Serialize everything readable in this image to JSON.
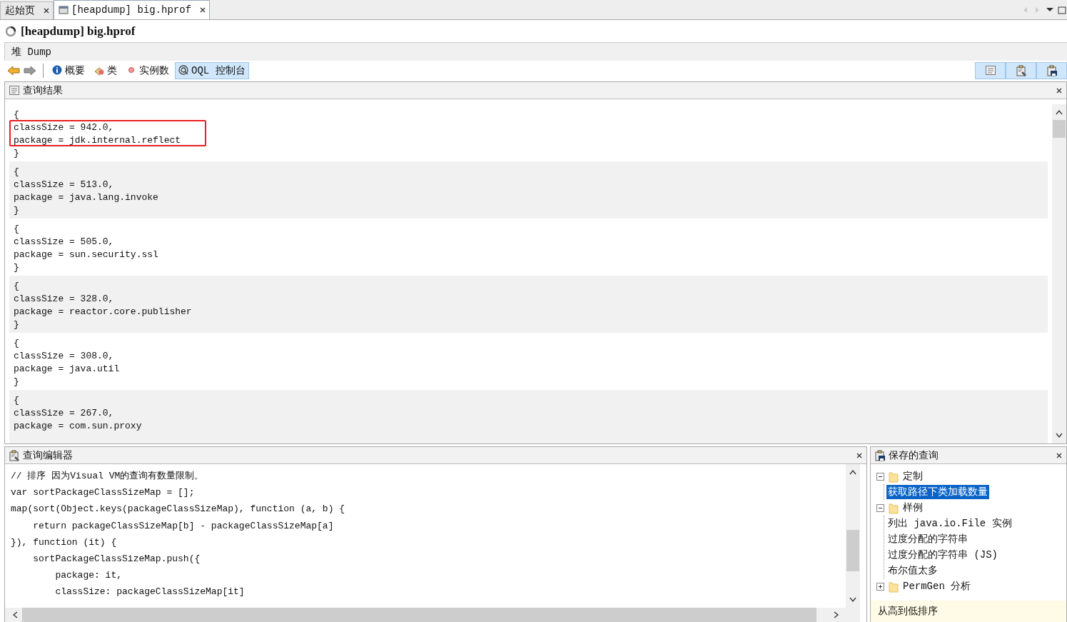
{
  "tabs": [
    {
      "label": "起始页",
      "selected": false,
      "icon": false
    },
    {
      "label": "[heapdump] big.hprof",
      "selected": true,
      "icon": true
    }
  ],
  "title": "[heapdump] big.hprof",
  "subtab": "堆 Dump",
  "toolbar": [
    {
      "label": "概要",
      "kind": "info",
      "selected": false
    },
    {
      "label": "类",
      "kind": "classes",
      "selected": false
    },
    {
      "label": "实例数",
      "kind": "instances",
      "selected": false
    },
    {
      "label": "OQL 控制台",
      "kind": "oql",
      "selected": true
    }
  ],
  "results": {
    "title": "查询结果",
    "records": [
      {
        "lines": [
          "{",
          "classSize = 942.0,",
          "package = jdk.internal.reflect",
          "}"
        ],
        "highlighted": true
      },
      {
        "lines": [
          "{",
          "classSize = 513.0,",
          "package = java.lang.invoke",
          "}"
        ],
        "highlighted": false
      },
      {
        "lines": [
          "{",
          "classSize = 505.0,",
          "package = sun.security.ssl",
          "}"
        ],
        "highlighted": false
      },
      {
        "lines": [
          "{",
          "classSize = 328.0,",
          "package = reactor.core.publisher",
          "}"
        ],
        "highlighted": false
      },
      {
        "lines": [
          "{",
          "classSize = 308.0,",
          "package = java.util",
          "}"
        ],
        "highlighted": false
      },
      {
        "lines": [
          "{",
          "classSize = 267.0,",
          "package = com.sun.proxy"
        ],
        "highlighted": false
      }
    ]
  },
  "editor": {
    "title": "查询编辑器",
    "lines": [
      "// 排序 因为Visual VM的查询有数量限制。",
      "var sortPackageClassSizeMap = [];",
      "map(sort(Object.keys(packageClassSizeMap), function (a, b) {",
      "    return packageClassSizeMap[b] - packageClassSizeMap[a]",
      "}), function (it) {",
      "    sortPackageClassSizeMap.push({",
      "        package: it,",
      "        classSize: packageClassSizeMap[it]"
    ]
  },
  "saved": {
    "title": "保存的查询",
    "tree": [
      {
        "label": "定制",
        "expanded": true,
        "children": [
          {
            "label": "获取路径下类加载数量",
            "selected": true
          }
        ]
      },
      {
        "label": "样例",
        "expanded": true,
        "children": [
          {
            "label": "列出 java.io.File 实例",
            "selected": false
          },
          {
            "label": "过度分配的字符串",
            "selected": false
          },
          {
            "label": "过度分配的字符串 (JS)",
            "selected": false
          },
          {
            "label": "布尔值太多",
            "selected": false
          }
        ]
      },
      {
        "label": "PermGen 分析",
        "expanded": false
      }
    ],
    "tooltip": "从高到低排序"
  }
}
